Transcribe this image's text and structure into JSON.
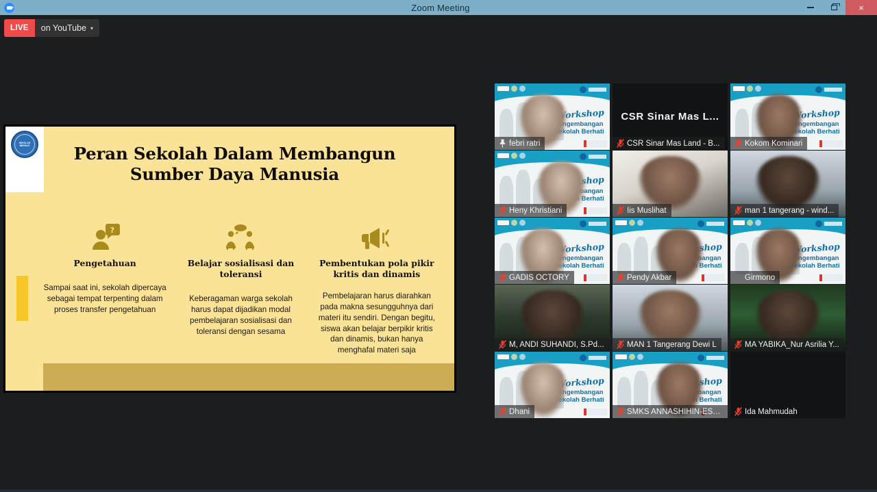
{
  "window": {
    "title": "Zoom Meeting",
    "minimize_label": "Minimize",
    "restore_label": "Restore",
    "close_label": "×",
    "titlebar_color": "#7eafc8"
  },
  "live_badge": {
    "status": "LIVE",
    "platform": "on YouTube",
    "caret": "▾",
    "accent_color": "#ef4b4b"
  },
  "shared_slide": {
    "title": "Peran Sekolah Dalam Membangun Sumber Daya Manusia",
    "logo_text": "SEKOLAH BERHATI",
    "background_color": "#fae396",
    "accent_color": "#f6c62b",
    "footer_color": "#ccad53",
    "columns": [
      {
        "icon": "person-question-icon",
        "heading": "Pengetahuan",
        "body": "Sampai saat ini, sekolah dipercaya sebagai tempat terpenting dalam proses transfer pengetahuan"
      },
      {
        "icon": "people-talking-icon",
        "heading": "Belajar sosialisasi dan toleransi",
        "body": "Keberagaman warga sekolah harus dapat dijadikan modal pembelajaran sosialisasi dan toleransi dengan sesama"
      },
      {
        "icon": "megaphone-icon",
        "heading": "Pembentukan pola pikir kritis dan dinamis",
        "body": "Pembelajaran harus diarahkan pada makna sesungguhnya  dari materi itu sendiri.  Dengan begitu, siswa akan belajar berpikir kritis dan dinamis, bukan hanya menghafal materi saja"
      }
    ]
  },
  "virtual_background": {
    "script_word": "Workshop",
    "line1": "Pengembangan",
    "line2": "Sekolah Berhati"
  },
  "participants": [
    {
      "name": "febri ratri",
      "icon": "pin-icon",
      "muted": false,
      "pinned": true,
      "active_speaker": true,
      "video": "virtual-bg",
      "camera": "cam-a"
    },
    {
      "name": "CSR Sinar Mas Land - B...",
      "display_name": "CSR Sinar Mas L...",
      "icon": "muted-mic-icon",
      "muted": true,
      "pinned": false,
      "active_speaker": false,
      "video": "name-only",
      "camera": ""
    },
    {
      "name": "Kokom Kominari",
      "icon": "muted-mic-icon",
      "muted": true,
      "pinned": false,
      "active_speaker": false,
      "video": "virtual-bg",
      "camera": ""
    },
    {
      "name": "Heny Khristiani",
      "icon": "muted-mic-icon",
      "muted": true,
      "pinned": false,
      "active_speaker": false,
      "video": "virtual-bg",
      "camera": ""
    },
    {
      "name": "Iis Muslihat",
      "icon": "muted-mic-icon",
      "muted": true,
      "pinned": false,
      "active_speaker": false,
      "video": "camera",
      "camera": "cam-b"
    },
    {
      "name": "man 1 tangerang - wind...",
      "icon": "muted-mic-icon",
      "muted": true,
      "pinned": false,
      "active_speaker": false,
      "video": "camera",
      "camera": "cam-d"
    },
    {
      "name": "GADIS OCTORY",
      "icon": "muted-mic-icon",
      "muted": true,
      "pinned": false,
      "active_speaker": false,
      "video": "virtual-bg",
      "camera": ""
    },
    {
      "name": "Pendy Akbar",
      "icon": "muted-mic-icon",
      "muted": true,
      "pinned": false,
      "active_speaker": false,
      "video": "virtual-bg",
      "camera": ""
    },
    {
      "name": "Girmono",
      "icon": "",
      "muted": false,
      "pinned": false,
      "active_speaker": false,
      "video": "virtual-bg",
      "camera": ""
    },
    {
      "name": "M, ANDI SUHANDI, S.Pd...",
      "icon": "muted-mic-icon",
      "muted": true,
      "pinned": false,
      "active_speaker": false,
      "video": "camera",
      "camera": "cam-c"
    },
    {
      "name": "MAN 1 Tangerang Dewi L",
      "icon": "muted-mic-icon",
      "muted": true,
      "pinned": false,
      "active_speaker": false,
      "video": "camera",
      "camera": "cam-d"
    },
    {
      "name": "MA YABIKA_Nur Asrilia Y...",
      "icon": "muted-mic-icon",
      "muted": true,
      "pinned": false,
      "active_speaker": false,
      "video": "camera",
      "camera": "cam-e"
    },
    {
      "name": "Dhani",
      "icon": "muted-mic-icon",
      "muted": true,
      "pinned": false,
      "active_speaker": false,
      "video": "virtual-bg",
      "camera": ""
    },
    {
      "name": "SMKS ANNASHIHIN-EST...",
      "icon": "muted-mic-icon",
      "muted": true,
      "pinned": false,
      "active_speaker": false,
      "video": "virtual-bg",
      "camera": ""
    },
    {
      "name": "Ida Mahmudah",
      "icon": "muted-mic-icon",
      "muted": true,
      "pinned": false,
      "active_speaker": false,
      "video": "none",
      "camera": ""
    }
  ]
}
